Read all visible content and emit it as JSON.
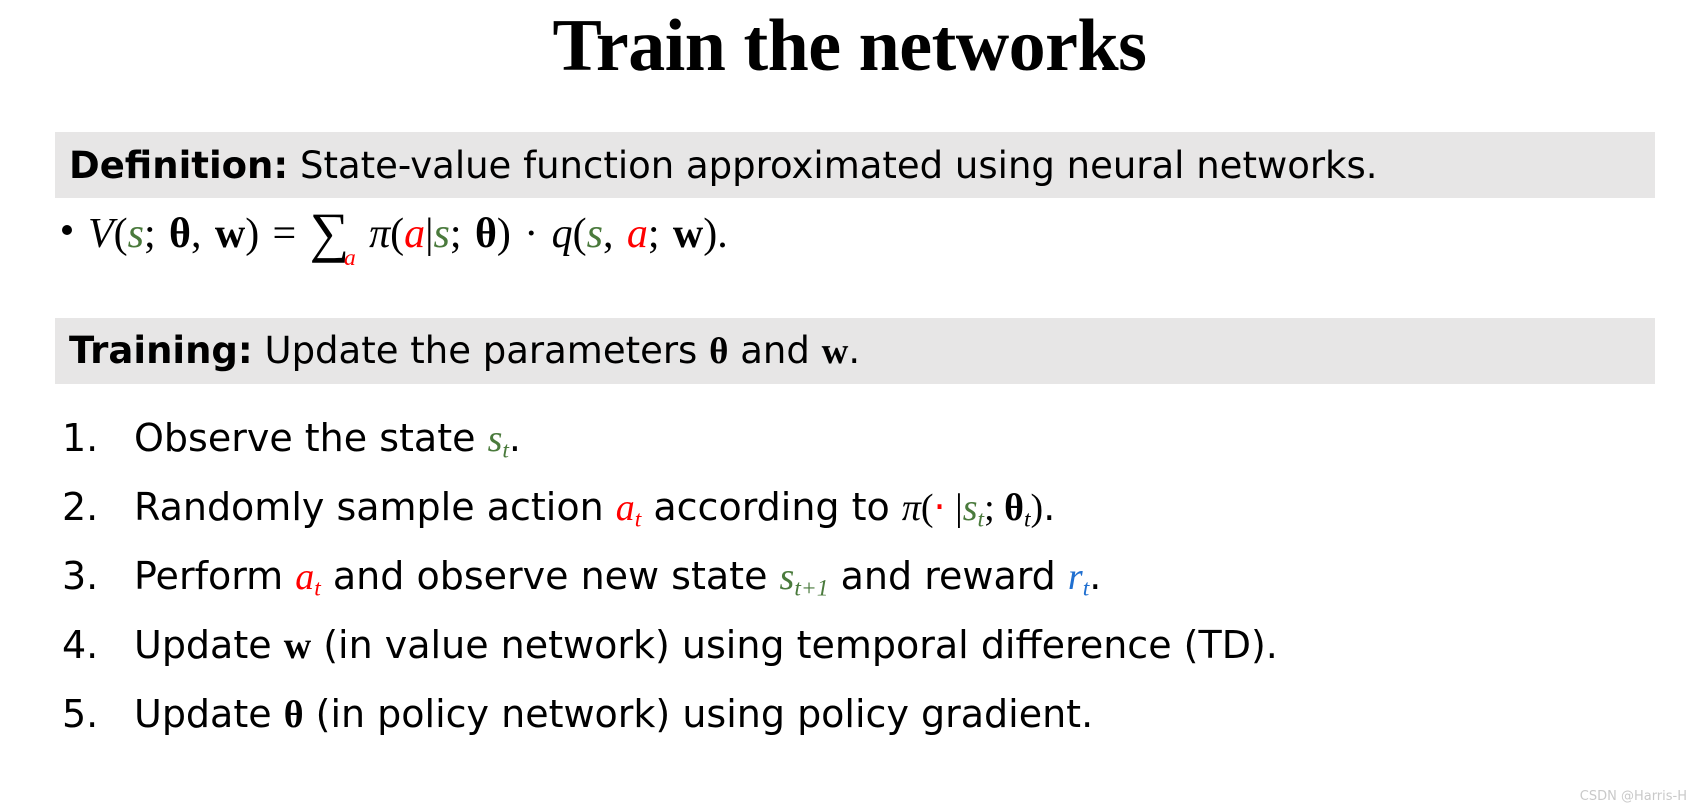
{
  "slide": {
    "title": "Train the networks",
    "watermark": "CSDN @Harris-H"
  },
  "definition": {
    "label": "Definition:",
    "text": "State-value function approximated using neural networks.",
    "formula_plain": "V(s; θ, w) = ∑_a π(a|s; θ) · q(s, a; w).",
    "parts": {
      "V": "V",
      "open1": "(",
      "s1": "s",
      "semi1": ";",
      "theta1": "θ",
      "comma1": ",",
      "w1": "w",
      "close1": ")",
      "equals": "=",
      "sum": "∑",
      "sum_sub": "a",
      "pi": "π",
      "open2": "(",
      "a1": "a",
      "bar": "|",
      "s2": "s",
      "semi2": ";",
      "theta2": "θ",
      "close2": ")",
      "cdot": "·",
      "q": "q",
      "open3": "(",
      "s3": "s",
      "comma2": ",",
      "a2": "a",
      "semi3": ";",
      "w2": "w",
      "close3": ")",
      "period": "."
    }
  },
  "training": {
    "label": "Training:",
    "text_before": "Update the parameters ",
    "theta": "θ",
    "text_middle": " and ",
    "w": "w",
    "text_after": "."
  },
  "steps": [
    {
      "number": "1.",
      "plain": "Observe the state s_t.",
      "pre": "Observe the state ",
      "var": "s",
      "sub": "t",
      "post": "."
    },
    {
      "number": "2.",
      "plain": "Randomly sample action a_t according to π(· |s_t; θ_t).",
      "pre": "Randomly sample action ",
      "var": "a",
      "sub": "t",
      "mid": " according to ",
      "pi": "π",
      "open": "(",
      "dot": "·",
      "bar": " |",
      "s": "s",
      "s_sub": "t",
      "semi": "; ",
      "theta": "θ",
      "theta_sub": "t",
      "close": ")",
      "post": "."
    },
    {
      "number": "3.",
      "plain": "Perform a_t and observe new state s_{t+1} and reward r_t.",
      "pre": "Perform ",
      "var": "a",
      "sub": "t",
      "mid": " and observe new state ",
      "s": "s",
      "s_sub": "t+1",
      "mid2": " and reward ",
      "r": "r",
      "r_sub": "t",
      "post": "."
    },
    {
      "number": "4.",
      "plain": "Update w (in value network) using temporal difference (TD).",
      "pre": "Update ",
      "var": "w",
      "post": " (in value network) using temporal difference (TD)."
    },
    {
      "number": "5.",
      "plain": "Update θ (in policy network) using policy gradient.",
      "pre": "Update ",
      "var": "θ",
      "post": " (in policy network) using policy gradient."
    }
  ],
  "colors": {
    "banner_background": "#e7e6e6",
    "state_green": "#4a7a3c",
    "action_red": "#ff0000",
    "reward_blue": "#1f6fd0",
    "text_black": "#000000",
    "watermark_gray": "#c9c9c9"
  }
}
